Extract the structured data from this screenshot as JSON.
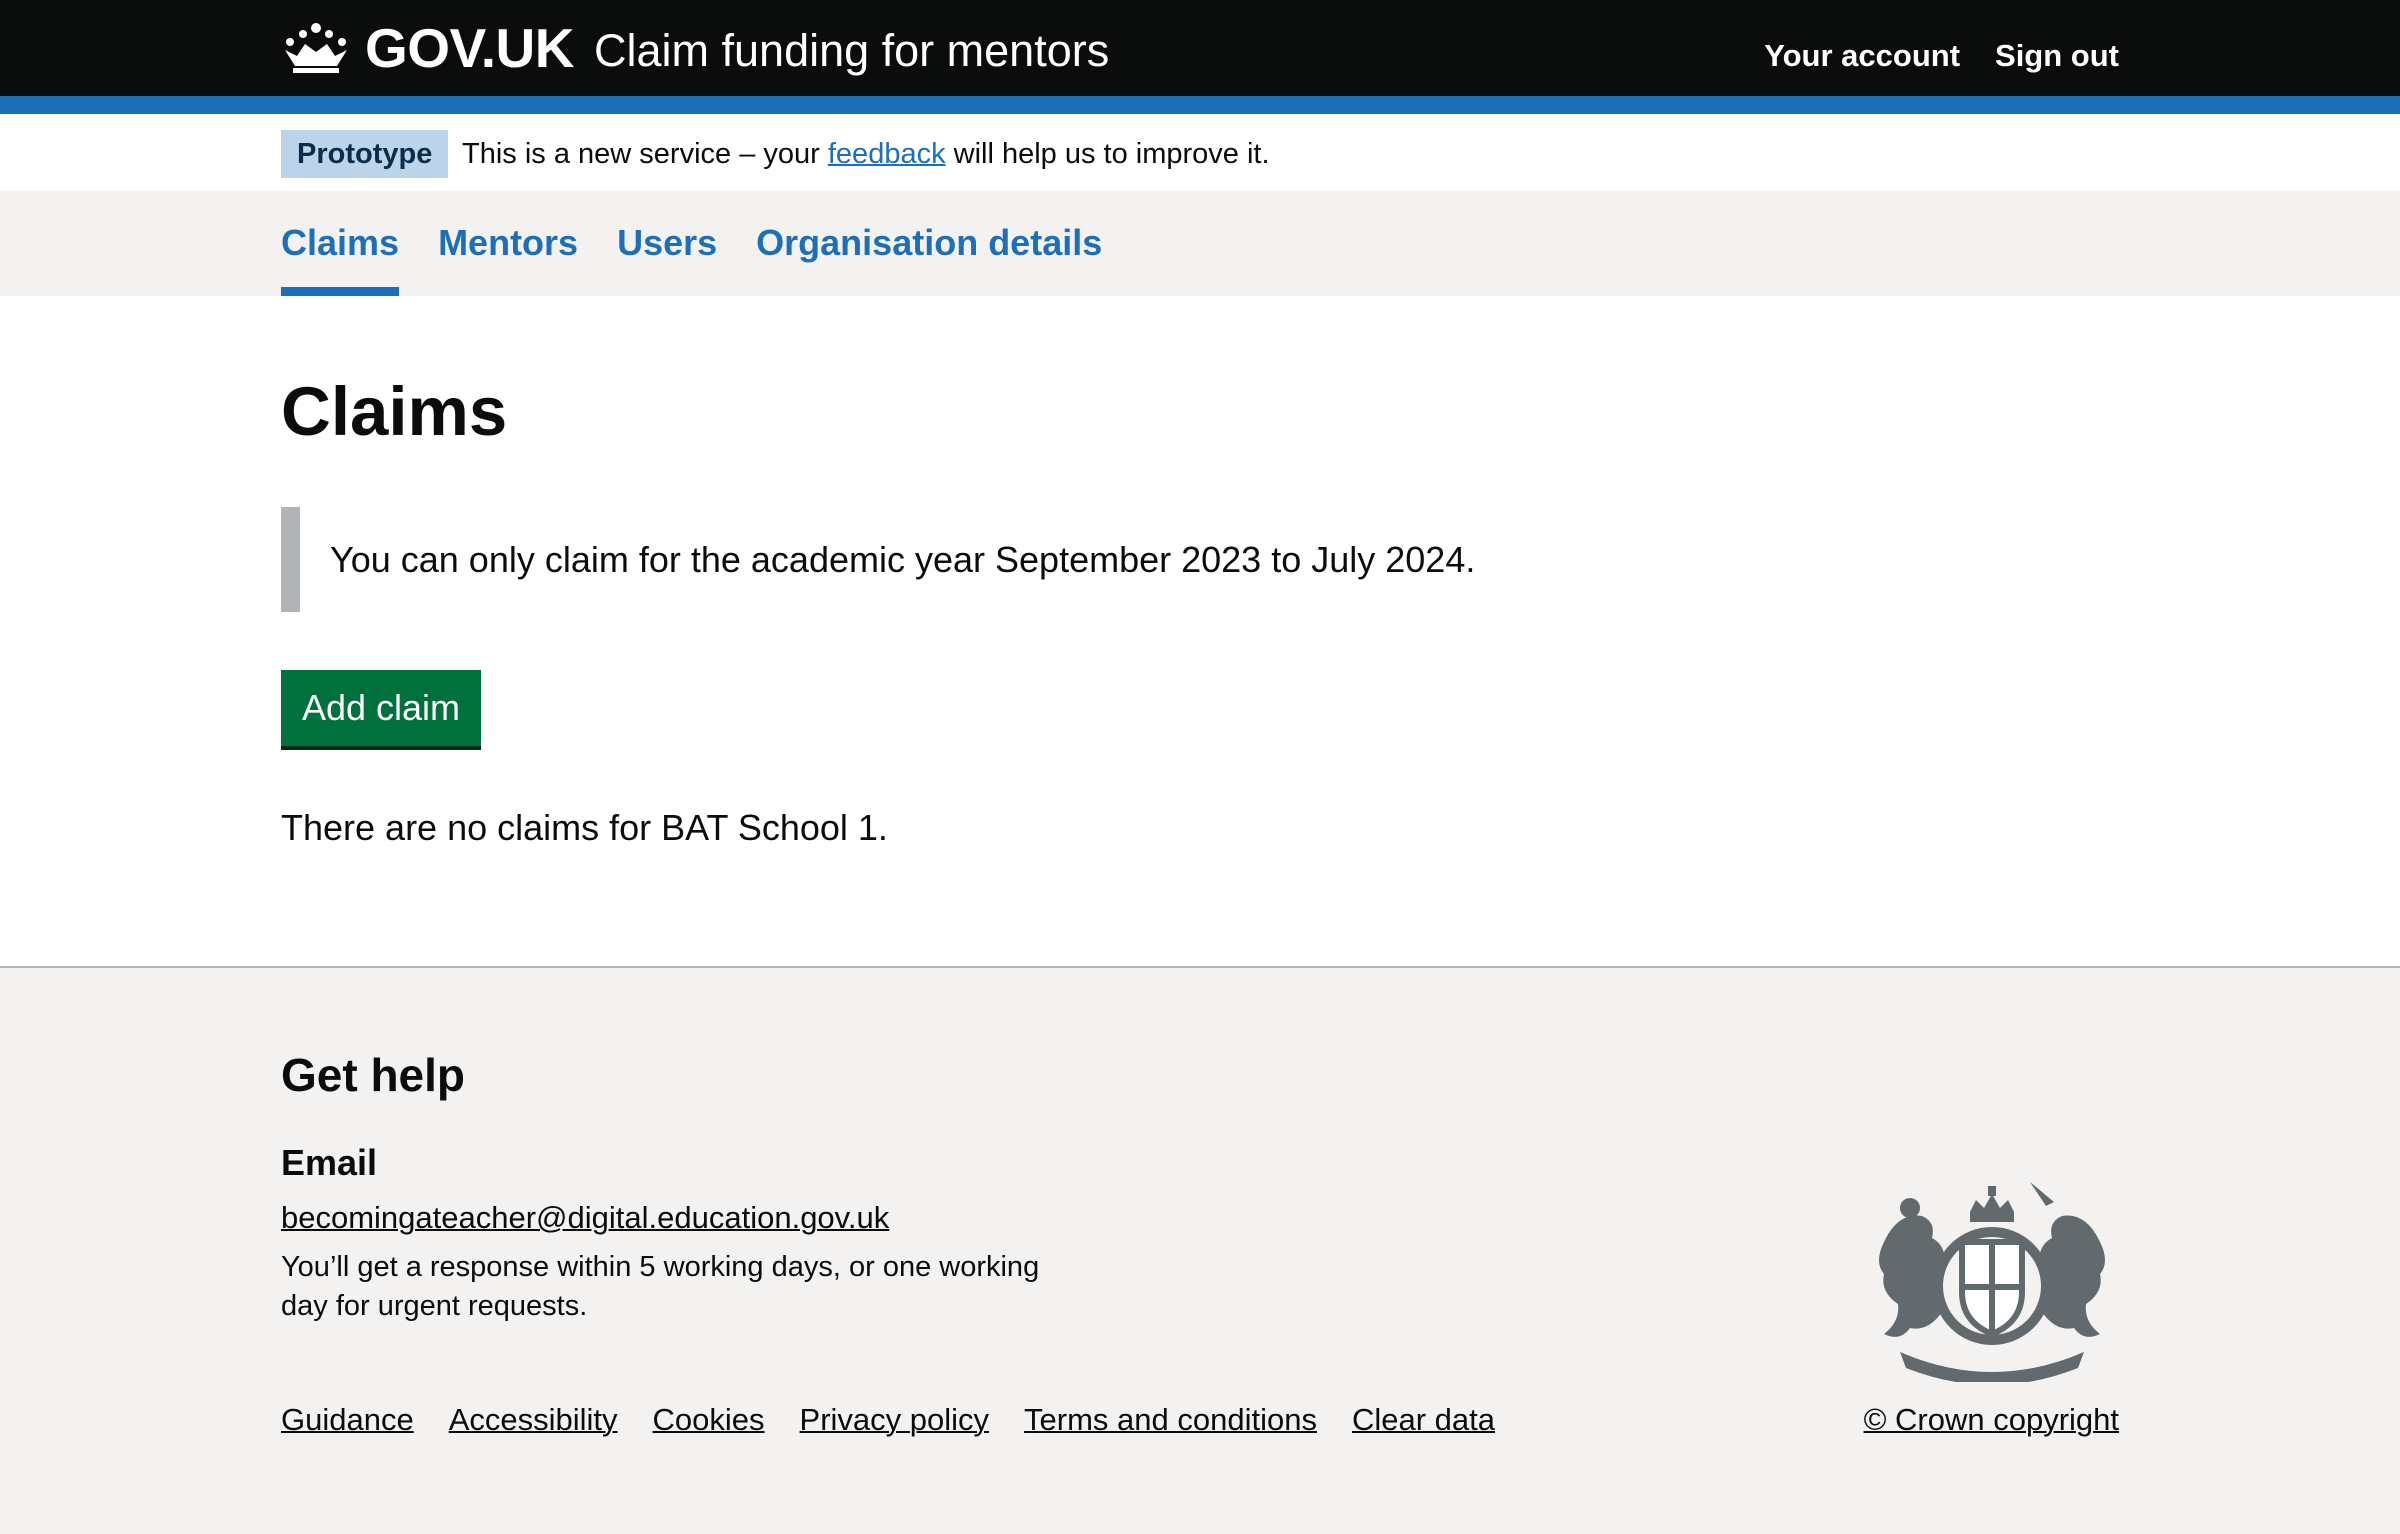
{
  "header": {
    "logo_text": "GOV.UK",
    "service_name": "Claim funding for mentors",
    "links": [
      "Your account",
      "Sign out"
    ]
  },
  "phase_banner": {
    "tag": "Prototype",
    "text_before": "This is a new service – your",
    "link": "feedback",
    "text_after": "will help us to improve it."
  },
  "nav": {
    "items": [
      "Claims",
      "Mentors",
      "Users",
      "Organisation details"
    ],
    "active": "Claims"
  },
  "main": {
    "title": "Claims",
    "inset": "You can only claim for the academic year September 2023 to July 2024.",
    "button": "Add claim",
    "empty_message": "There are no claims for BAT School 1."
  },
  "footer": {
    "help_title": "Get help",
    "email_heading": "Email",
    "email": "becomingateacher@digital.education.gov.uk",
    "response_line1": "You’ll get a response within 5 working days, or one working",
    "response_line2": "day for urgent requests.",
    "links": [
      "Guidance",
      "Accessibility",
      "Cookies",
      "Privacy policy",
      "Terms and conditions",
      "Clear data"
    ],
    "copyright": "© Crown copyright"
  },
  "colors": {
    "header_bg": "#0b0c0c",
    "brand_blue": "#1d70b8",
    "button_green": "#00703c",
    "footer_bg": "#f3f2f1",
    "phase_tag_bg": "#bbd4ea"
  }
}
